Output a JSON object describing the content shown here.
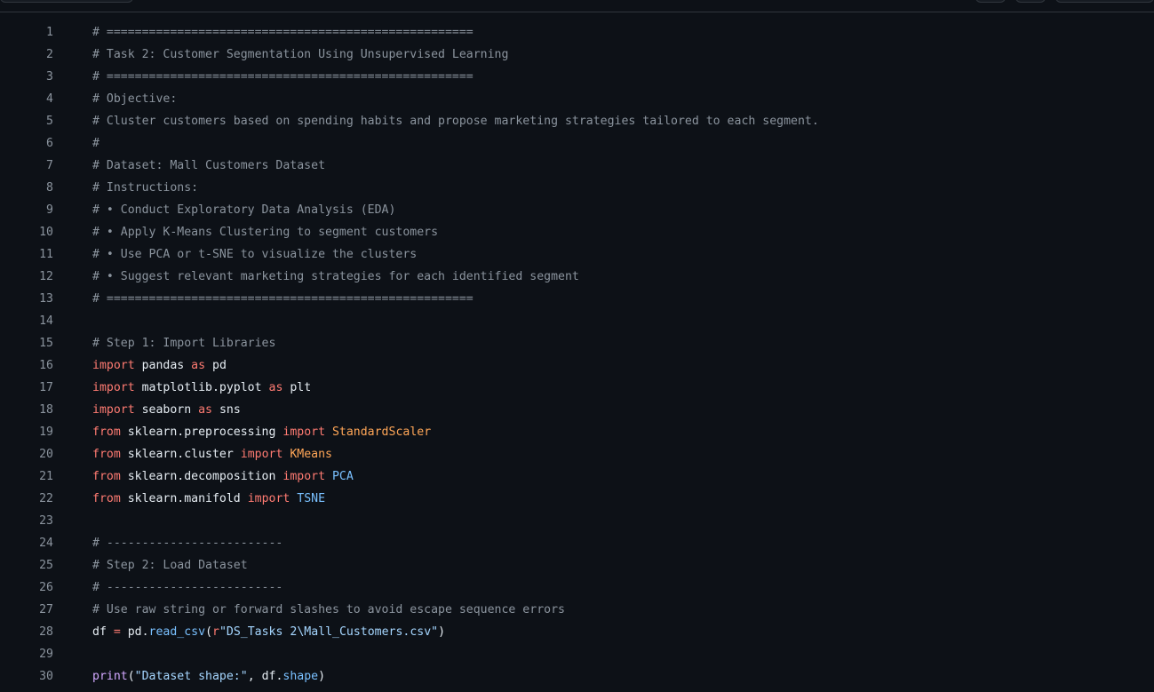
{
  "colors": {
    "background": "#0d1117",
    "line_number": "#8b949e",
    "comment": "#8b949e",
    "keyword": "#ff7b72",
    "plain": "#e6edf3",
    "class": "#ffa657",
    "constant": "#79c0ff",
    "string": "#a5d6ff",
    "function": "#d2a8ff"
  },
  "code_lines": [
    {
      "n": "1",
      "tokens": [
        {
          "t": "comment",
          "v": "# ===================================================="
        }
      ]
    },
    {
      "n": "2",
      "tokens": [
        {
          "t": "comment",
          "v": "# Task 2: Customer Segmentation Using Unsupervised Learning"
        }
      ]
    },
    {
      "n": "3",
      "tokens": [
        {
          "t": "comment",
          "v": "# ===================================================="
        }
      ]
    },
    {
      "n": "4",
      "tokens": [
        {
          "t": "comment",
          "v": "# Objective:"
        }
      ]
    },
    {
      "n": "5",
      "tokens": [
        {
          "t": "comment",
          "v": "# Cluster customers based on spending habits and propose marketing strategies tailored to each segment."
        }
      ]
    },
    {
      "n": "6",
      "tokens": [
        {
          "t": "comment",
          "v": "#"
        }
      ]
    },
    {
      "n": "7",
      "tokens": [
        {
          "t": "comment",
          "v": "# Dataset: Mall Customers Dataset"
        }
      ]
    },
    {
      "n": "8",
      "tokens": [
        {
          "t": "comment",
          "v": "# Instructions:"
        }
      ]
    },
    {
      "n": "9",
      "tokens": [
        {
          "t": "comment",
          "v": "# • Conduct Exploratory Data Analysis (EDA)"
        }
      ]
    },
    {
      "n": "10",
      "tokens": [
        {
          "t": "comment",
          "v": "# • Apply K-Means Clustering to segment customers"
        }
      ]
    },
    {
      "n": "11",
      "tokens": [
        {
          "t": "comment",
          "v": "# • Use PCA or t-SNE to visualize the clusters"
        }
      ]
    },
    {
      "n": "12",
      "tokens": [
        {
          "t": "comment",
          "v": "# • Suggest relevant marketing strategies for each identified segment"
        }
      ]
    },
    {
      "n": "13",
      "tokens": [
        {
          "t": "comment",
          "v": "# ===================================================="
        }
      ]
    },
    {
      "n": "14",
      "tokens": []
    },
    {
      "n": "15",
      "tokens": [
        {
          "t": "comment",
          "v": "# Step 1: Import Libraries"
        }
      ]
    },
    {
      "n": "16",
      "tokens": [
        {
          "t": "keyword",
          "v": "import"
        },
        {
          "t": "plain",
          "v": " pandas "
        },
        {
          "t": "keyword",
          "v": "as"
        },
        {
          "t": "plain",
          "v": " pd"
        }
      ]
    },
    {
      "n": "17",
      "tokens": [
        {
          "t": "keyword",
          "v": "import"
        },
        {
          "t": "plain",
          "v": " matplotlib.pyplot "
        },
        {
          "t": "keyword",
          "v": "as"
        },
        {
          "t": "plain",
          "v": " plt"
        }
      ]
    },
    {
      "n": "18",
      "tokens": [
        {
          "t": "keyword",
          "v": "import"
        },
        {
          "t": "plain",
          "v": " seaborn "
        },
        {
          "t": "keyword",
          "v": "as"
        },
        {
          "t": "plain",
          "v": " sns"
        }
      ]
    },
    {
      "n": "19",
      "tokens": [
        {
          "t": "keyword",
          "v": "from"
        },
        {
          "t": "plain",
          "v": " sklearn.preprocessing "
        },
        {
          "t": "keyword",
          "v": "import"
        },
        {
          "t": "plain",
          "v": " "
        },
        {
          "t": "class",
          "v": "StandardScaler"
        }
      ]
    },
    {
      "n": "20",
      "tokens": [
        {
          "t": "keyword",
          "v": "from"
        },
        {
          "t": "plain",
          "v": " sklearn.cluster "
        },
        {
          "t": "keyword",
          "v": "import"
        },
        {
          "t": "plain",
          "v": " "
        },
        {
          "t": "class",
          "v": "KMeans"
        }
      ]
    },
    {
      "n": "21",
      "tokens": [
        {
          "t": "keyword",
          "v": "from"
        },
        {
          "t": "plain",
          "v": " sklearn.decomposition "
        },
        {
          "t": "keyword",
          "v": "import"
        },
        {
          "t": "plain",
          "v": " "
        },
        {
          "t": "const",
          "v": "PCA"
        }
      ]
    },
    {
      "n": "22",
      "tokens": [
        {
          "t": "keyword",
          "v": "from"
        },
        {
          "t": "plain",
          "v": " sklearn.manifold "
        },
        {
          "t": "keyword",
          "v": "import"
        },
        {
          "t": "plain",
          "v": " "
        },
        {
          "t": "const",
          "v": "TSNE"
        }
      ]
    },
    {
      "n": "23",
      "tokens": []
    },
    {
      "n": "24",
      "tokens": [
        {
          "t": "comment",
          "v": "# -------------------------"
        }
      ]
    },
    {
      "n": "25",
      "tokens": [
        {
          "t": "comment",
          "v": "# Step 2: Load Dataset"
        }
      ]
    },
    {
      "n": "26",
      "tokens": [
        {
          "t": "comment",
          "v": "# -------------------------"
        }
      ]
    },
    {
      "n": "27",
      "tokens": [
        {
          "t": "comment",
          "v": "# Use raw string or forward slashes to avoid escape sequence errors"
        }
      ]
    },
    {
      "n": "28",
      "tokens": [
        {
          "t": "plain",
          "v": "df "
        },
        {
          "t": "op",
          "v": "="
        },
        {
          "t": "plain",
          "v": " pd."
        },
        {
          "t": "const",
          "v": "read_csv"
        },
        {
          "t": "plain",
          "v": "("
        },
        {
          "t": "keyword",
          "v": "r"
        },
        {
          "t": "string",
          "v": "\"DS_Tasks 2\\Mall_Customers.csv\""
        },
        {
          "t": "plain",
          "v": ")"
        }
      ]
    },
    {
      "n": "29",
      "tokens": []
    },
    {
      "n": "30",
      "tokens": [
        {
          "t": "func",
          "v": "print"
        },
        {
          "t": "plain",
          "v": "("
        },
        {
          "t": "string",
          "v": "\"Dataset shape:\""
        },
        {
          "t": "plain",
          "v": ", df."
        },
        {
          "t": "const",
          "v": "shape"
        },
        {
          "t": "plain",
          "v": ")"
        }
      ]
    }
  ]
}
